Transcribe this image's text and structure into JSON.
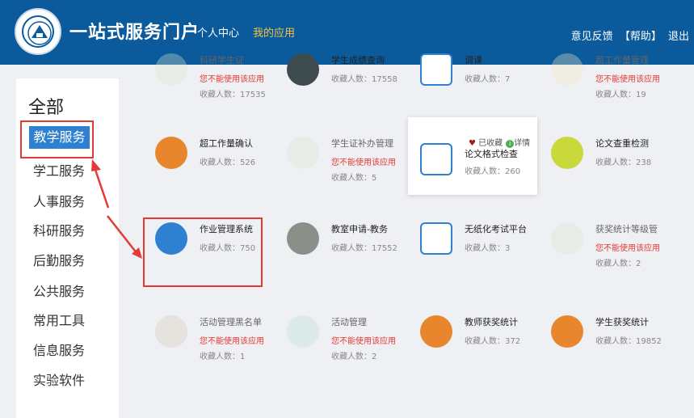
{
  "header": {
    "portal_title": "一站式服务门户",
    "nav_personal": "个人中心",
    "nav_apps": "我的应用",
    "feedback": "意见反馈",
    "help": "【帮助】",
    "logout": "退出"
  },
  "sidebar": {
    "all_label": "全部",
    "items": [
      "教学服务",
      "学工服务",
      "人事服务",
      "科研服务",
      "后勤服务",
      "公共服务",
      "常用工具",
      "信息服务",
      "实验软件"
    ]
  },
  "cards": [
    {
      "title": "科研学生证",
      "line2": "您不能使用该应用",
      "line3": "收藏人数：17535",
      "disabled": true,
      "color": "#d9e6cf"
    },
    {
      "title": "学生成绩查询",
      "line2": "收藏人数：17558",
      "line3": "",
      "disabled": false,
      "color": "#3d4b4f"
    },
    {
      "title": "调课",
      "line2": "收藏人数：7",
      "line3": "",
      "disabled": false,
      "color": "#ffffff"
    },
    {
      "title": "超工作量管理",
      "line2": "您不能使用该应用",
      "line3": "收藏人数：19",
      "disabled": true,
      "color": "#f3e7c6"
    },
    {
      "title": "超工作量确认",
      "line2": "收藏人数：526",
      "line3": "",
      "disabled": false,
      "color": "#e8862e"
    },
    {
      "title": "学生证补办管理",
      "line2": "您不能使用该应用",
      "line3": "收藏人数：5",
      "disabled": true,
      "color": "#d9e6cf"
    },
    {
      "title": "论文格式检查",
      "line2": "收藏人数：260",
      "line3": "",
      "disabled": false,
      "color": "#ffffff"
    },
    {
      "title": "论文查重检测",
      "line2": "收藏人数：238",
      "line3": "",
      "disabled": false,
      "color": "#c9d93c"
    },
    {
      "title": "作业管理系统",
      "line2": "收藏人数：750",
      "line3": "",
      "disabled": false,
      "color": "#2f80d1"
    },
    {
      "title": "教室申请-教务",
      "line2": "收藏人数：17552",
      "line3": "",
      "disabled": false,
      "color": "#8a8f8a"
    },
    {
      "title": "无纸化考试平台",
      "line2": "收藏人数：3",
      "line3": "",
      "disabled": false,
      "color": "#ffffff"
    },
    {
      "title": "获奖统计等级管",
      "line2": "您不能使用该应用",
      "line3": "收藏人数：2",
      "disabled": true,
      "color": "#d9e6cf"
    },
    {
      "title": "活动管理黑名单",
      "line2": "您不能使用该应用",
      "line3": "收藏人数：1",
      "disabled": true,
      "color": "#d8c9b4"
    },
    {
      "title": "活动管理",
      "line2": "您不能使用该应用",
      "line3": "收藏人数：2",
      "disabled": true,
      "color": "#b9e3d8"
    },
    {
      "title": "教师获奖统计",
      "line2": "收藏人数：372",
      "line3": "",
      "disabled": false,
      "color": "#e8862e"
    },
    {
      "title": "学生获奖统计",
      "line2": "收藏人数：19852",
      "line3": "",
      "disabled": false,
      "color": "#e8862e"
    }
  ],
  "hover_card": {
    "favorited": "已收藏",
    "details": "详情"
  },
  "colors": {
    "header": "#0a5a9c",
    "accent": "#2f80d1",
    "highlight": "#e53935",
    "disabled_text": "#e53935"
  }
}
